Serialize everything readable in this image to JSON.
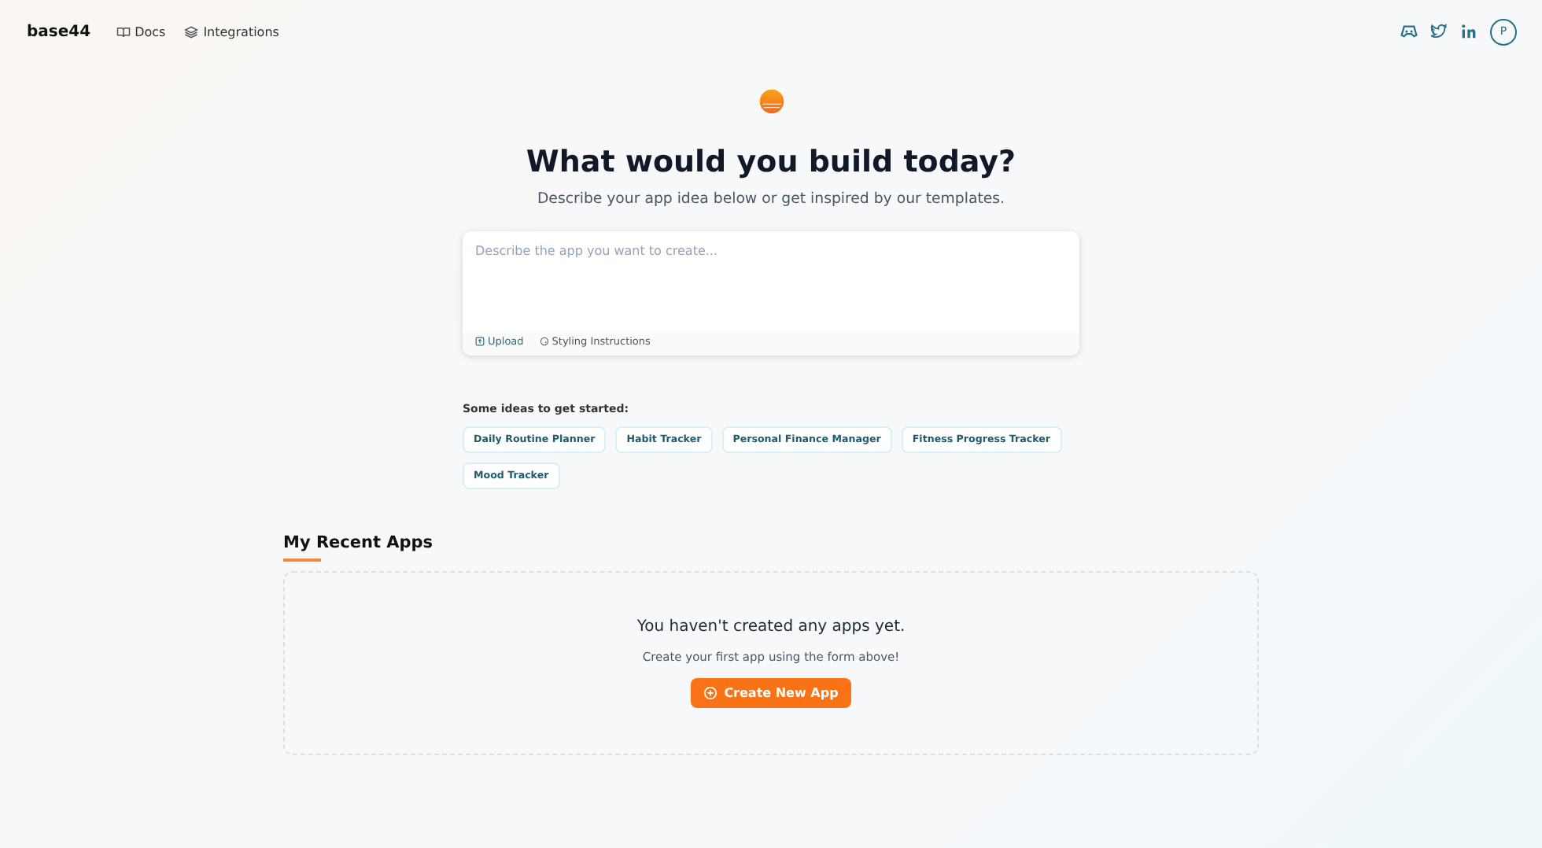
{
  "header": {
    "brand": "base44",
    "nav": [
      {
        "label": "Docs"
      },
      {
        "label": "Integrations"
      }
    ],
    "avatar": "P"
  },
  "hero": {
    "title": "What would you build today?",
    "subtitle": "Describe your app idea below or get inspired by our templates."
  },
  "prompt": {
    "placeholder": "Describe the app you want to create...",
    "actions": [
      {
        "label": "Upload",
        "kind": "upload"
      },
      {
        "label": "Styling Instructions",
        "kind": "style"
      }
    ]
  },
  "ideas": {
    "label": "Some ideas to get started:",
    "items": [
      "Daily Routine Planner",
      "Habit Tracker",
      "Personal Finance Manager",
      "Fitness Progress Tracker",
      "Mood Tracker"
    ]
  },
  "recent": {
    "title": "My Recent Apps",
    "empty_title": "You haven't created any apps yet.",
    "empty_text": "Create your first app using the form above!",
    "button": "Create New App"
  }
}
